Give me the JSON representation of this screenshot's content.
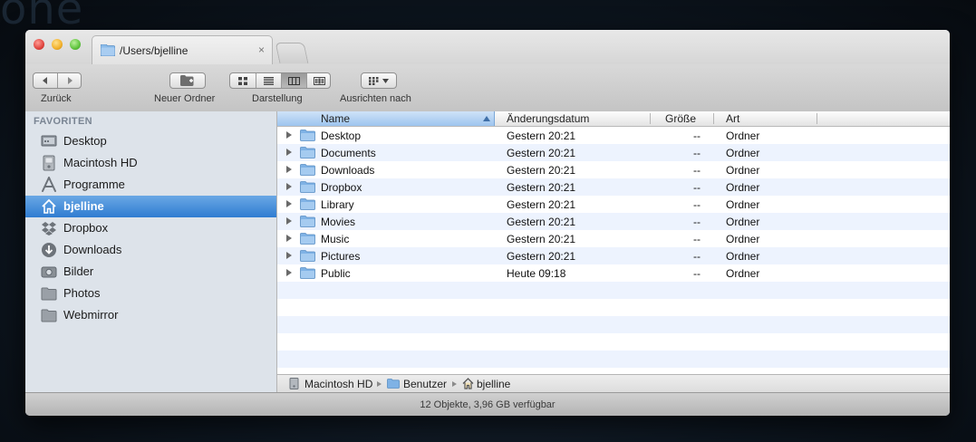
{
  "window": {
    "tab_title": "/Users/bjelline",
    "tab_close": "×"
  },
  "toolbar": {
    "back_label": "Zurück",
    "new_folder_label": "Neuer Ordner",
    "view_label": "Darstellung",
    "arrange_label": "Ausrichten nach"
  },
  "sidebar": {
    "heading": "FAVORITEN",
    "items": [
      {
        "label": "Desktop",
        "icon": "desktop-icon"
      },
      {
        "label": "Macintosh HD",
        "icon": "hard-drive-icon"
      },
      {
        "label": "Programme",
        "icon": "applications-icon"
      },
      {
        "label": "bjelline",
        "icon": "home-icon",
        "selected": true
      },
      {
        "label": "Dropbox",
        "icon": "dropbox-icon"
      },
      {
        "label": "Downloads",
        "icon": "downloads-icon"
      },
      {
        "label": "Bilder",
        "icon": "camera-icon"
      },
      {
        "label": "Photos",
        "icon": "folder-icon"
      },
      {
        "label": "Webmirror",
        "icon": "folder-icon"
      }
    ]
  },
  "columns": {
    "name": "Name",
    "date": "Änderungsdatum",
    "size": "Größe",
    "kind": "Art"
  },
  "files": [
    {
      "name": "Desktop",
      "date": "Gestern 20:21",
      "size": "--",
      "kind": "Ordner"
    },
    {
      "name": "Documents",
      "date": "Gestern 20:21",
      "size": "--",
      "kind": "Ordner"
    },
    {
      "name": "Downloads",
      "date": "Gestern 20:21",
      "size": "--",
      "kind": "Ordner"
    },
    {
      "name": "Dropbox",
      "date": "Gestern 20:21",
      "size": "--",
      "kind": "Ordner"
    },
    {
      "name": "Library",
      "date": "Gestern 20:21",
      "size": "--",
      "kind": "Ordner"
    },
    {
      "name": "Movies",
      "date": "Gestern 20:21",
      "size": "--",
      "kind": "Ordner"
    },
    {
      "name": "Music",
      "date": "Gestern 20:21",
      "size": "--",
      "kind": "Ordner"
    },
    {
      "name": "Pictures",
      "date": "Gestern 20:21",
      "size": "--",
      "kind": "Ordner"
    },
    {
      "name": "Public",
      "date": "Heute 09:18",
      "size": "--",
      "kind": "Ordner"
    }
  ],
  "pathbar": {
    "items": [
      "Macintosh HD",
      "Benutzer",
      "bjelline"
    ]
  },
  "status": {
    "text": "12 Objekte, 3,96 GB verfügbar"
  },
  "colors": {
    "selection": "#3a86d6",
    "sidebar_bg": "#dde3ea",
    "row_alt": "#edf3fe",
    "folder": "#7fb2e5"
  }
}
